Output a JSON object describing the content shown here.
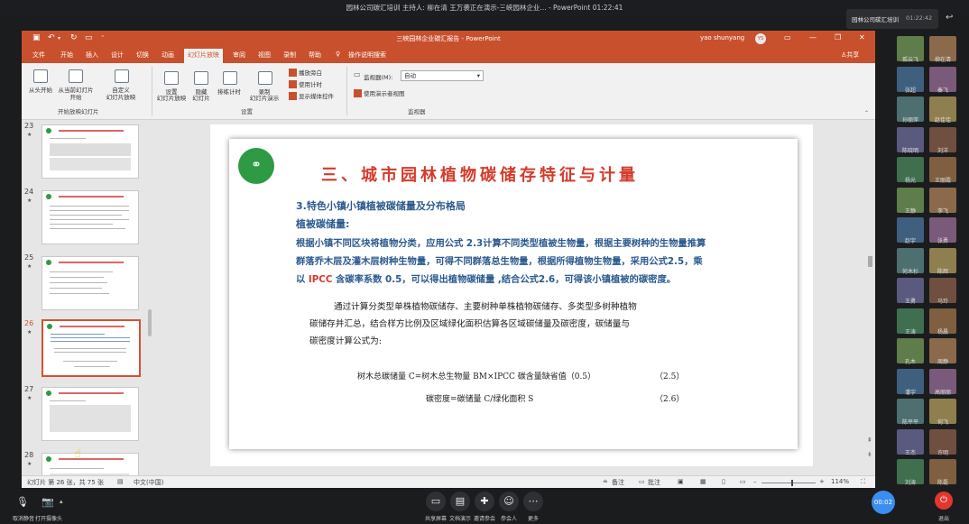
{
  "meeting": {
    "title": "园林公司碳汇培训   主持人: 柳在清   王万袭正在演示-三峡园林企业... - PowerPoint   01:22:41",
    "mini_window_title": "园林公司碳汇培训",
    "mini_window_time": "01:22:42"
  },
  "ppt": {
    "doc_title": "三峡园林企业碳汇报告 - PowerPoint",
    "user_name": "yao shunyang",
    "user_initials": "YS",
    "share_label": "共享",
    "tabs": [
      "文件",
      "开始",
      "插入",
      "设计",
      "切换",
      "动画",
      "幻灯片放映",
      "审阅",
      "视图",
      "录制",
      "帮助"
    ],
    "search_label": "操作说明搜索",
    "ribbon": {
      "from_start": "从头开始",
      "from_current_1": "从当前幻灯片",
      "from_current_2": "开始",
      "custom_1": "自定义",
      "custom_2": "幻灯片放映",
      "group_start": "开始放映幻灯片",
      "setup_1": "设置",
      "setup_2": "幻灯片放映",
      "hide_1": "隐藏",
      "hide_2": "幻灯片",
      "rehearse": "排练计时",
      "record_1": "录制",
      "record_2": "幻灯片演示",
      "chk_narration": "播放旁白",
      "chk_timings": "使用计时",
      "chk_media": "显示媒体控件",
      "group_setup": "设置",
      "monitor_label": "监视器(M):",
      "monitor_value": "自动",
      "presenter_view": "使用演示者视图",
      "group_monitor": "监视器"
    },
    "thumbnails": [
      {
        "num": "23",
        "star": "★"
      },
      {
        "num": "24",
        "star": "★"
      },
      {
        "num": "25",
        "star": "★"
      },
      {
        "num": "26",
        "star": "★"
      },
      {
        "num": "27",
        "star": "★"
      },
      {
        "num": "28",
        "star": "★"
      }
    ],
    "slide": {
      "title": "三、城市园林植物碳储存特征与计量",
      "heading1": "3.特色小镇小镇植被碳储量及分布格局",
      "heading2": "植被碳储量:",
      "para1": "根据小镇不同区块将植物分类，应用公式 2.3计算不同类型植被生物量，根据主要树种的生物量推算",
      "para2": "群落乔木层及灌木层树种生物量，可得不同群落总生物量，根据所得植物生物量，采用公式2.5，乘",
      "para3_pre": "以",
      "para3_ipcc": "IPCC",
      "para3_post": "含碳率系数 0.5，可以得出植物碳储量 ,结合公式2.6，可得该小镇植被的碳密度。",
      "body1": "通过计算分类型单株植物碳储存、主要树种单株植物碳储存、多类型多树种植物",
      "body2": "碳储存并汇总，结合样方比例及区域绿化面积估算各区域碳储量及碳密度，碳储量与",
      "body3": "碳密度计算公式为:",
      "formula1": "树木总碳储量 C=树木总生物量 BM×IPCC 碳含量缺省值（0.5）",
      "formula1_num": "（2.5）",
      "formula2": "碳密度=碳储量 C/绿化面积 S",
      "formula2_num": "（2.6）"
    },
    "status": {
      "slide_info": "幻灯片 第 26 张，共 75 张",
      "language": "中文(中国)",
      "notes": "备注",
      "comments": "批注",
      "zoom": "114%"
    }
  },
  "participants": [
    {
      "name": "孤云飞"
    },
    {
      "name": "柳在清"
    },
    {
      "name": "张超"
    },
    {
      "name": "秦飞"
    },
    {
      "name": "孙丽萍"
    },
    {
      "name": "赵佳佳"
    },
    {
      "name": "陈晓明"
    },
    {
      "name": "刘洋"
    },
    {
      "name": "杨光"
    },
    {
      "name": "王丽霞"
    },
    {
      "name": "王静"
    },
    {
      "name": "李飞"
    },
    {
      "name": "赵宇"
    },
    {
      "name": "张勇"
    },
    {
      "name": "何木杉"
    },
    {
      "name": "陈辉"
    },
    {
      "name": "王勇"
    },
    {
      "name": "马玲"
    },
    {
      "name": "王涛"
    },
    {
      "name": "杨晨"
    },
    {
      "name": "孔木"
    },
    {
      "name": "周静"
    },
    {
      "name": "潘宇"
    },
    {
      "name": "高丽丽"
    },
    {
      "name": "陈平平"
    },
    {
      "name": "何飞"
    },
    {
      "name": "王杰"
    },
    {
      "name": "许明"
    },
    {
      "name": "刘涛"
    },
    {
      "name": "陈磊"
    }
  ],
  "bottom": {
    "mute_label": "取消静音",
    "video_label": "打开摄像头",
    "share_label": "共享屏幕",
    "doc_label": "文档演示",
    "invite_label": "邀请参会",
    "members_label": "参会人",
    "more_label": "更多",
    "timer": "00:02",
    "leave_label": "退出"
  }
}
